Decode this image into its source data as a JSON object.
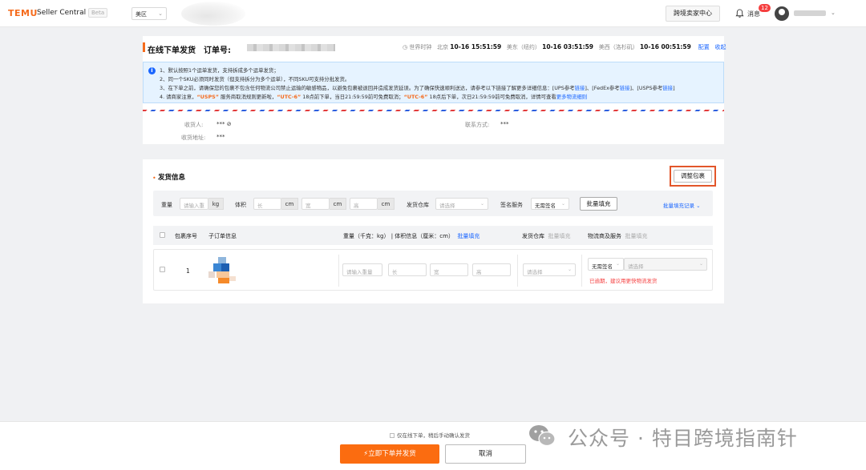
{
  "header": {
    "logo": "TEMU",
    "app_name": "Seller Central",
    "beta": "Beta",
    "region": "美区",
    "cross_border_center": "跨境卖家中心",
    "messages_label": "消息",
    "messages_count": "12"
  },
  "order": {
    "page_title": "在线下单发货",
    "order_label": "订单号:",
    "world_clock_label": "世界时钟",
    "clocks": [
      {
        "city": "北京",
        "time": "10-16 15:51:59"
      },
      {
        "city": "美东（纽约）",
        "time": "10-16 03:51:59"
      },
      {
        "city": "美西（洛杉矶）",
        "time": "10-16 00:51:59"
      }
    ],
    "config_link": "配置",
    "collapse_link": "收起"
  },
  "notice": {
    "line1": "1、默认按照1个运单发货，支持拆成多个运单发货；",
    "line2": "2、同一个SKU必须同时发货（但支持拆分为多个运单），不同SKU可支持分批发货。",
    "line3_text": "3、在下单之前，请确保您的包裹不包含任何物流公司禁止运输的敏感物品，以避免包裹被退回并造成发货延误。为了确保快速顺利送达，请参考以下链接了解更多详细信息：[UPS参考",
    "line3_link1": "链接",
    "line3_mid1": "]、[FedEx参考",
    "line3_link2": "链接",
    "line3_mid2": "]、[USPS参考",
    "line3_link3": "链接",
    "line3_end": "]",
    "line4_a": "4. 请商家注意，",
    "line4_usps": "“USPS”",
    "line4_b": "服务商取消规则更新啦，",
    "line4_utc1": "“UTC-6”",
    "line4_c": "18点前下单，当日21:59:59前可免费取消；",
    "line4_utc2": "“UTC-6”",
    "line4_d": "18点后下单，次日21:59:59前可免费取消，详情可查看",
    "line4_link": "更多物流细则"
  },
  "recipient": {
    "name_label": "收货人:",
    "name_value": "*** ⊘",
    "contact_label": "联系方式:",
    "contact_value": "***",
    "address_label": "收货地址:",
    "address_value": "***"
  },
  "shipping": {
    "title": "发货信息",
    "adjust_button": "调整包裹",
    "weight_label": "重量",
    "weight_placeholder": "请输入重",
    "weight_unit": "kg",
    "volume_label": "体积",
    "length_placeholder": "长",
    "width_placeholder": "宽",
    "height_placeholder": "高",
    "cm_unit": "cm",
    "warehouse_label": "发货仓库",
    "select_placeholder": "请选择",
    "signature_label": "签名服务",
    "signature_value": "无需签名",
    "batch_fill_button": "批量填充",
    "batch_fill_history": "批量填充记录"
  },
  "table": {
    "col_package_no": "包裹序号",
    "col_sub_order": "子订单信息",
    "col_weight_dims": "重量（千克：kg） | 体积信息（厘米：cm）",
    "col_batch_fill": "批量填充",
    "col_warehouse": "发货仓库",
    "col_warehouse_batch": "批量填充",
    "col_logistics": "物流商及服务",
    "col_logistics_batch": "批量填充",
    "rows": [
      {
        "index": "1",
        "weight_placeholder": "请输入重量",
        "length_placeholder": "长",
        "width_placeholder": "宽",
        "height_placeholder": "高",
        "warehouse_placeholder": "请选择",
        "signature_value": "无需签名",
        "logistics_placeholder": "请选择",
        "warning": "已逾期，建议用更快物流发货"
      }
    ]
  },
  "footer": {
    "checkbox_label": "仅在线下单，稍后手动确认发货",
    "submit_button": "⚡立即下单并发货",
    "cancel_button": "取消"
  },
  "watermark": {
    "text": "公众号 · 特目跨境指南针"
  },
  "colors": {
    "brand_orange": "#fb6c10",
    "link_blue": "#1a66ff",
    "warning_red": "#f53f3f",
    "highlight_frame": "#e2562a"
  }
}
